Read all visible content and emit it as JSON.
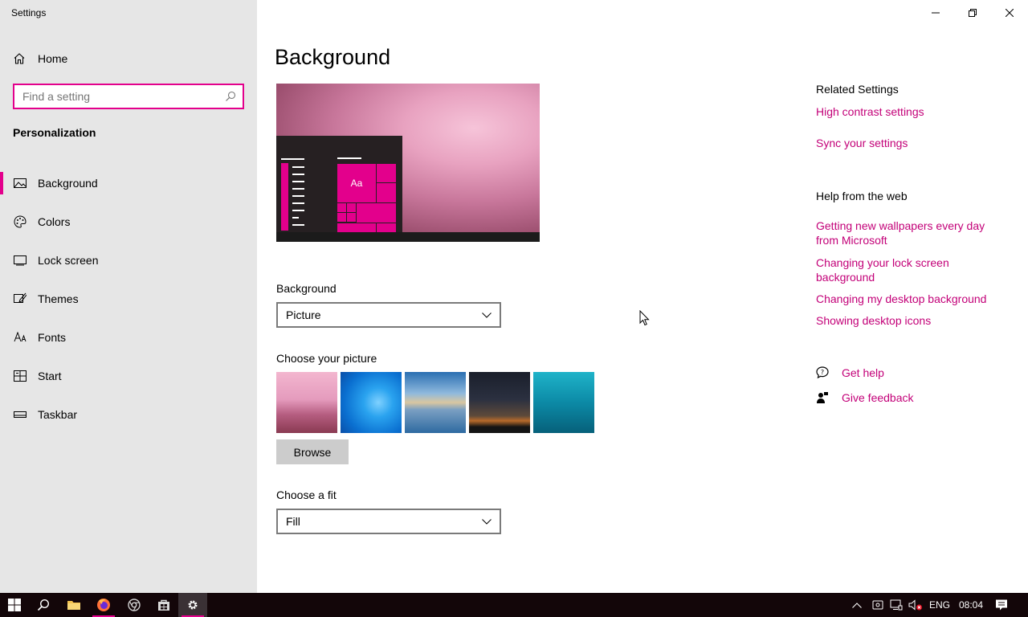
{
  "window": {
    "title": "Settings"
  },
  "sidebar": {
    "home_label": "Home",
    "search_placeholder": "Find a setting",
    "section_title": "Personalization",
    "items": [
      {
        "label": "Background",
        "icon": "picture-icon",
        "active": true
      },
      {
        "label": "Colors",
        "icon": "palette-icon"
      },
      {
        "label": "Lock screen",
        "icon": "monitor-icon"
      },
      {
        "label": "Themes",
        "icon": "brush-icon"
      },
      {
        "label": "Fonts",
        "icon": "font-icon"
      },
      {
        "label": "Start",
        "icon": "start-menu-icon"
      },
      {
        "label": "Taskbar",
        "icon": "taskbar-icon"
      }
    ]
  },
  "main": {
    "title": "Background",
    "preview": {
      "tile_text": "Aa"
    },
    "background_label": "Background",
    "background_value": "Picture",
    "choose_picture_label": "Choose your picture",
    "pictures": [
      "cherry-blossom-path",
      "windows-blue-logo",
      "beach-rock-reflection",
      "milky-way-tent",
      "underwater-swimmer"
    ],
    "browse_label": "Browse",
    "fit_label": "Choose a fit",
    "fit_value": "Fill"
  },
  "related": {
    "heading": "Related Settings",
    "links": [
      "High contrast settings",
      "Sync your settings"
    ]
  },
  "web_help": {
    "heading": "Help from the web",
    "links": [
      "Getting new wallpapers every day from Microsoft",
      "Changing your lock screen background",
      "Changing my desktop background",
      "Showing desktop icons"
    ]
  },
  "support": {
    "get_help": "Get help",
    "give_feedback": "Give feedback"
  },
  "taskbar": {
    "language": "ENG",
    "time": "08:04",
    "apps": [
      "start-icon",
      "search-icon",
      "file-explorer-icon",
      "firefox-icon",
      "chromium-icon",
      "store-icon",
      "settings-icon"
    ]
  },
  "colors": {
    "accent": "#e3008c",
    "link": "#c30078",
    "sidebar_bg": "#e6e6e6",
    "taskbar_bg": "#130609"
  }
}
